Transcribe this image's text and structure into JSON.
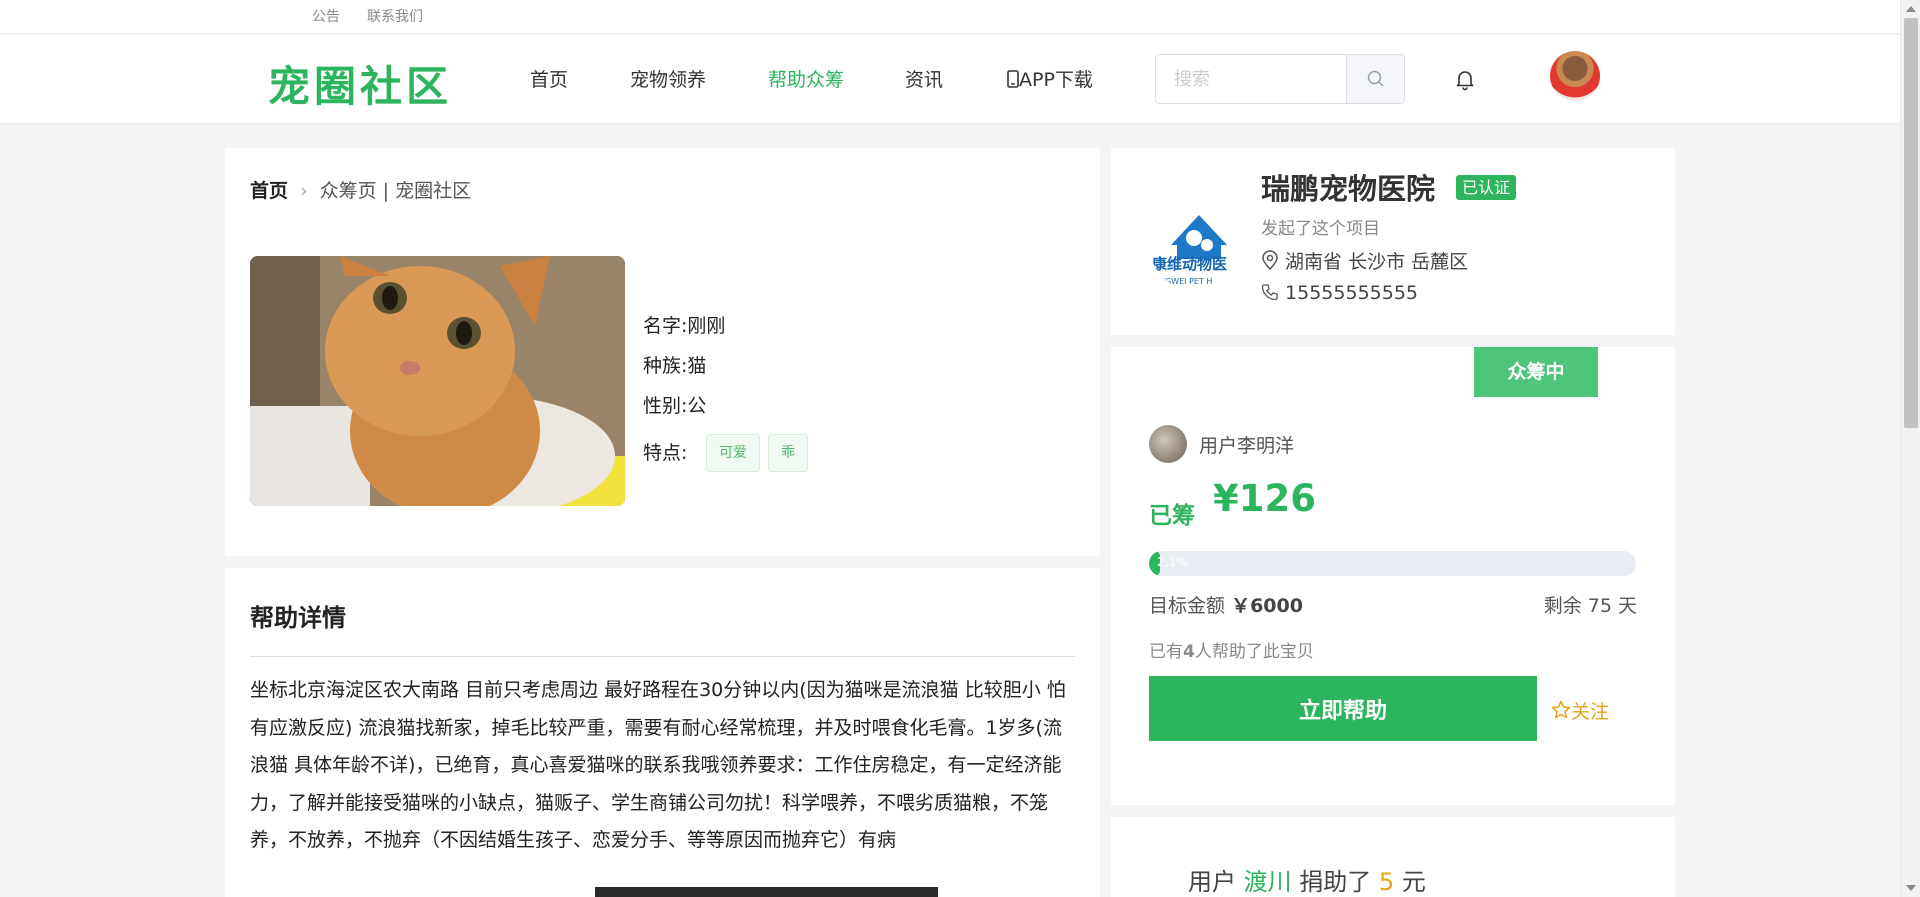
{
  "topbar": {
    "notice": "公告",
    "contact": "联系我们"
  },
  "header": {
    "logo": "宠圈社区",
    "nav": [
      {
        "label": "首页",
        "active": false
      },
      {
        "label": "宠物领养",
        "active": false
      },
      {
        "label": "帮助众筹",
        "active": true
      },
      {
        "label": "资讯",
        "active": false
      },
      {
        "label": "APP下载",
        "icon": "phone-icon",
        "active": false
      }
    ],
    "search_placeholder": "搜索",
    "icons": [
      "search-icon",
      "bell-icon",
      "user-avatar"
    ]
  },
  "breadcrumb": {
    "home": "首页",
    "current": "众筹页 | 宠圈社区"
  },
  "pet": {
    "name_label": "名字:",
    "name": "刚刚",
    "species_label": "种族:",
    "species": "猫",
    "gender_label": "性别:",
    "gender": "公",
    "traits_label": "特点:",
    "traits": [
      "可爱",
      "乖"
    ]
  },
  "detail": {
    "title": "帮助详情",
    "text": "坐标北京海淀区农大南路 目前只考虑周边 最好路程在30分钟以内(因为猫咪是流浪猫 比较胆小 怕有应激反应) 流浪猫找新家，掉毛比较严重，需要有耐心经常梳理，并及时喂食化毛膏。1岁多(流浪猫 具体年龄不详)，已绝育，真心喜爱猫咪的联系我哦领养要求：工作住房稳定，有一定经济能力，了解并能接受猫咪的小缺点，猫贩子、学生商铺公司勿扰！科学喂养，不喂劣质猫粮，不笼养，不放养，不抛弃（不因结婚生孩子、恋爱分手、等等原因而抛弃它）有病"
  },
  "hospital": {
    "name": "瑞鹏宠物医院",
    "verified": "已认证",
    "initiated": "发起了这个项目",
    "location": "湖南省 长沙市 岳麓区",
    "phone": "15555555555",
    "logo_text_main": "康维动物医",
    "logo_text_sub": "NGWEI PET H"
  },
  "campaign": {
    "status": "众筹中",
    "user": "用户李明洋",
    "raised_label": "已筹",
    "raised": "¥126",
    "progress_percent": 2.1,
    "progress_text": "2.1%",
    "goal_label": "目标金额",
    "goal": "￥6000",
    "remaining": "剩余 75 天",
    "helpers_prefix": "已有",
    "helpers_count": "4",
    "helpers_suffix": "人帮助了此宝贝",
    "help_button": "立即帮助",
    "follow": "关注"
  },
  "donation": {
    "prefix": "用户",
    "donor": "渡川",
    "middle": "捐助了",
    "amount": "5",
    "unit": "元"
  },
  "colors": {
    "brand": "#2db55d",
    "accent": "#e5a31a"
  }
}
